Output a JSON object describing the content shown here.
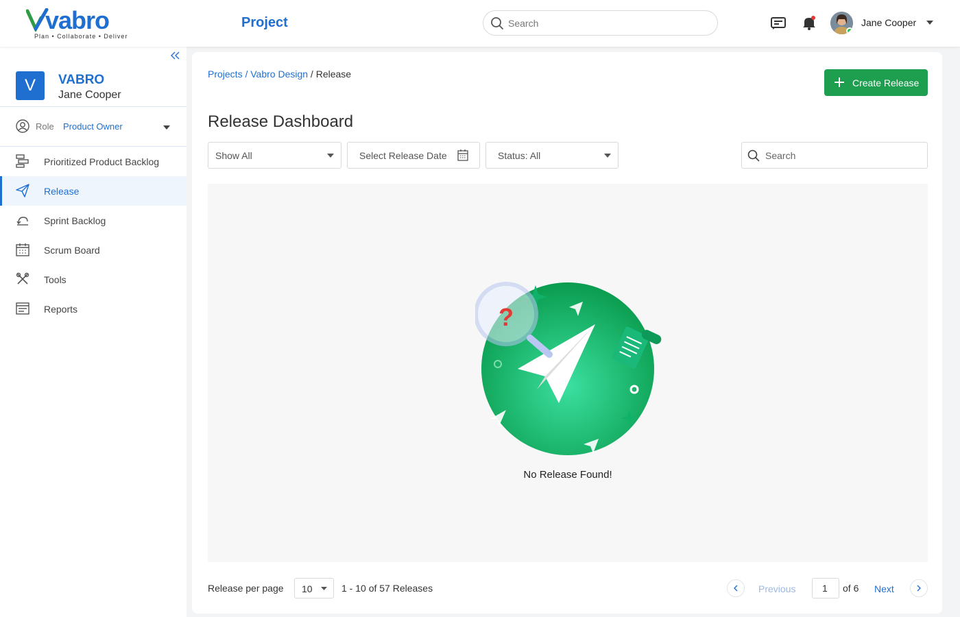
{
  "brand": {
    "name": "vabro",
    "tagline": "Plan • Collaborate • Deliver",
    "color": "#1f6fd1"
  },
  "header": {
    "title": "Project",
    "search_placeholder": "Search",
    "user_name": "Jane Cooper"
  },
  "sidebar": {
    "workspace_initial": "V",
    "workspace_name": "VABRO",
    "workspace_user": "Jane Cooper",
    "role_label": "Role",
    "role_value": "Product Owner",
    "items": [
      {
        "label": "Prioritized Product Backlog",
        "icon": "backlog-icon"
      },
      {
        "label": "Release",
        "icon": "send-icon",
        "active": true
      },
      {
        "label": "Sprint Backlog",
        "icon": "sprint-icon"
      },
      {
        "label": "Scrum Board",
        "icon": "calendar-icon"
      },
      {
        "label": "Tools",
        "icon": "tools-icon"
      },
      {
        "label": "Reports",
        "icon": "reports-icon"
      }
    ]
  },
  "main": {
    "breadcrumb": {
      "projects": "Projects",
      "separator": " / ",
      "project": "Vabro Design",
      "current": "Release"
    },
    "create_button": "Create Release",
    "title": "Release Dashboard",
    "filters": {
      "show": "Show All",
      "date": "Select Release Date",
      "status": "Status: All"
    },
    "search_placeholder": "Search",
    "empty_message": "No Release Found!"
  },
  "pagination": {
    "per_page_label": "Release per page",
    "per_page_value": "10",
    "range": "1 - 10 of 57 Releases",
    "previous": "Previous",
    "current_page": "1",
    "of_total": "of 6",
    "next": "Next"
  },
  "colors": {
    "accent": "#1f6fd1",
    "create_button": "#1e9e4f",
    "active_nav_bg": "#eef5fd"
  }
}
